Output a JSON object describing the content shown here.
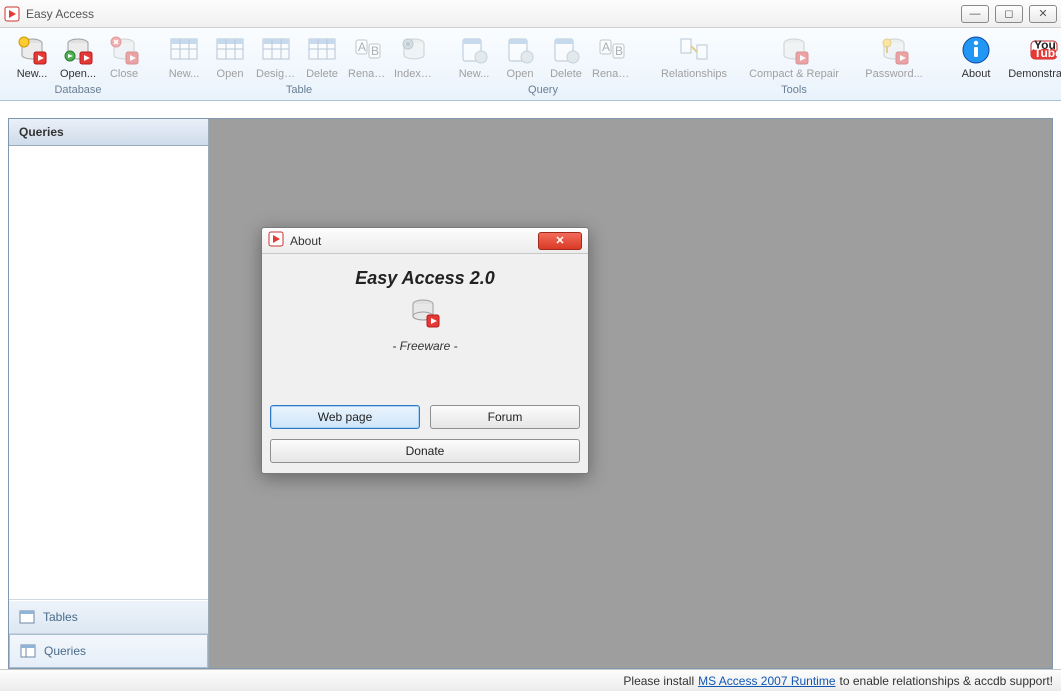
{
  "window": {
    "title": "Easy Access"
  },
  "winbuttons": {
    "min": "—",
    "max": "◻",
    "close": "✕"
  },
  "ribbon": {
    "groups": [
      {
        "label": "Database",
        "items": [
          {
            "key": "db-new",
            "label": "New...",
            "enabled": true,
            "icon": "db-new"
          },
          {
            "key": "db-open",
            "label": "Open...",
            "enabled": true,
            "icon": "db-open"
          },
          {
            "key": "db-close",
            "label": "Close",
            "enabled": false,
            "icon": "db-close"
          }
        ]
      },
      {
        "label": "Table",
        "items": [
          {
            "key": "t-new",
            "label": "New...",
            "enabled": false,
            "icon": "table"
          },
          {
            "key": "t-open",
            "label": "Open",
            "enabled": false,
            "icon": "table"
          },
          {
            "key": "t-design",
            "label": "Design...",
            "enabled": false,
            "icon": "table"
          },
          {
            "key": "t-delete",
            "label": "Delete",
            "enabled": false,
            "icon": "table"
          },
          {
            "key": "t-rename",
            "label": "Rename",
            "enabled": false,
            "icon": "rename"
          },
          {
            "key": "t-index",
            "label": "Indexes...",
            "enabled": false,
            "icon": "index"
          }
        ]
      },
      {
        "label": "Query",
        "items": [
          {
            "key": "q-new",
            "label": "New...",
            "enabled": false,
            "icon": "query"
          },
          {
            "key": "q-open",
            "label": "Open",
            "enabled": false,
            "icon": "query"
          },
          {
            "key": "q-delete",
            "label": "Delete",
            "enabled": false,
            "icon": "query"
          },
          {
            "key": "q-rename",
            "label": "Rename",
            "enabled": false,
            "icon": "rename"
          }
        ]
      },
      {
        "label": "Tools",
        "items": [
          {
            "key": "rel",
            "label": "Relationships",
            "enabled": false,
            "icon": "rel",
            "wide": "w80"
          },
          {
            "key": "cr",
            "label": "Compact & Repair",
            "enabled": false,
            "icon": "repair",
            "wide": "wide"
          },
          {
            "key": "pwd",
            "label": "Password...",
            "enabled": false,
            "icon": "pwd",
            "wide": "w80"
          }
        ]
      },
      {
        "label": "",
        "items": [
          {
            "key": "about",
            "label": "About",
            "enabled": true,
            "icon": "about"
          },
          {
            "key": "demo",
            "label": "Demonstration",
            "enabled": true,
            "icon": "youtube",
            "wide": "w80"
          }
        ]
      }
    ]
  },
  "sidebar": {
    "header": "Queries",
    "nav": [
      {
        "key": "tables",
        "label": "Tables",
        "active": false
      },
      {
        "key": "queries",
        "label": "Queries",
        "active": true
      }
    ]
  },
  "about": {
    "title": "About",
    "heading": "Easy Access 2.0",
    "subtitle": "- Freeware -",
    "buttons": {
      "web": "Web page",
      "forum": "Forum",
      "donate": "Donate"
    },
    "close": "✕"
  },
  "status": {
    "prefix": "Please install",
    "link": "MS Access 2007 Runtime",
    "suffix": "to enable relationships & accdb support!"
  }
}
